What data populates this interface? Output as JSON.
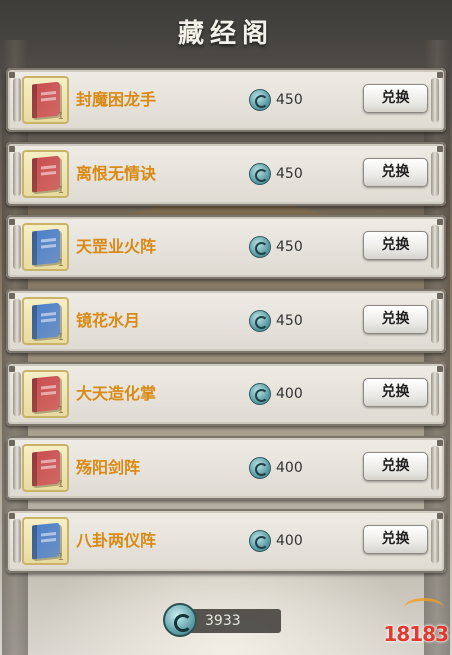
{
  "header": {
    "title": "藏经阁"
  },
  "items": [
    {
      "name": "封魔困龙手",
      "price": "450",
      "book_color": "#c94b50",
      "count": "1",
      "button": "兑换"
    },
    {
      "name": "离恨无情诀",
      "price": "450",
      "book_color": "#c94b50",
      "count": "1",
      "button": "兑换"
    },
    {
      "name": "天罡业火阵",
      "price": "450",
      "book_color": "#4b7ec9",
      "count": "1",
      "button": "兑换"
    },
    {
      "name": "镜花水月",
      "price": "450",
      "book_color": "#4b7ec9",
      "count": "1",
      "button": "兑换"
    },
    {
      "name": "大天造化掌",
      "price": "400",
      "book_color": "#c94b50",
      "count": "1",
      "button": "兑换"
    },
    {
      "name": "殇阳剑阵",
      "price": "400",
      "book_color": "#c94b50",
      "count": "1",
      "button": "兑换"
    },
    {
      "name": "八卦两仪阵",
      "price": "400",
      "book_color": "#4b7ec9",
      "count": "1",
      "button": "兑换"
    }
  ],
  "footer": {
    "currency_icon": "spiral-coin-icon",
    "balance": "3933"
  },
  "watermark": {
    "text": "18183"
  },
  "colors": {
    "name_text": "#d98a14",
    "watermark": "#e23a2f"
  }
}
